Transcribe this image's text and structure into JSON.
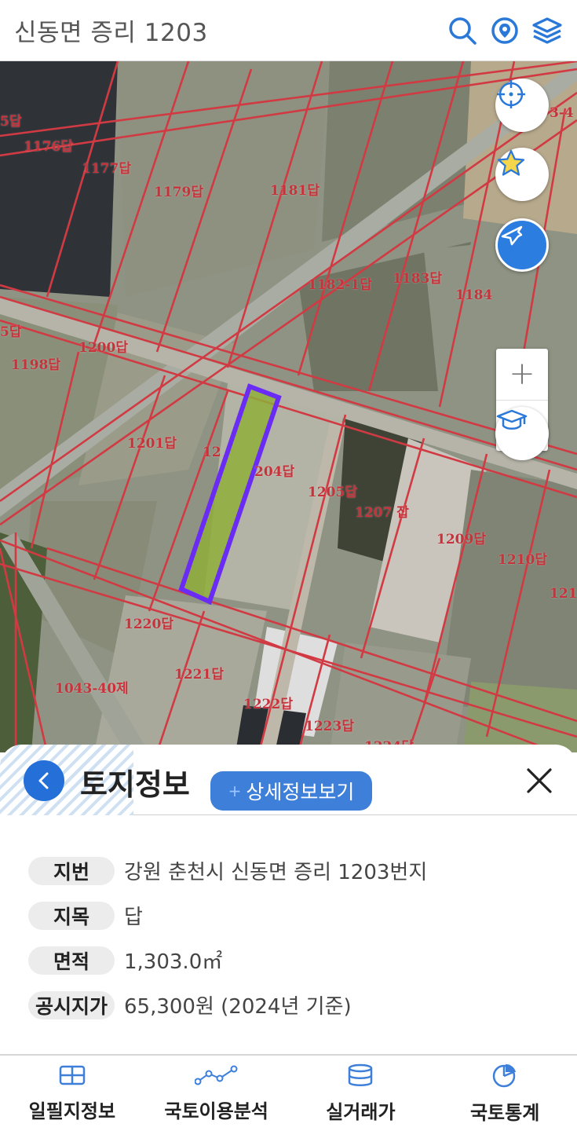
{
  "header": {
    "title": "신동면 증리 1203",
    "icons": [
      "search-icon",
      "location-pin-icon",
      "layers-icon"
    ]
  },
  "map": {
    "parcel_labels": [
      {
        "text": "5답"
      },
      {
        "text": "1176답"
      },
      {
        "text": "1177답"
      },
      {
        "text": "1179답"
      },
      {
        "text": "1181답"
      },
      {
        "text": "1182-1답"
      },
      {
        "text": "1183답"
      },
      {
        "text": "1184"
      },
      {
        "text": "5답"
      },
      {
        "text": "1200답"
      },
      {
        "text": "1198답"
      },
      {
        "text": "1201답"
      },
      {
        "text": "12"
      },
      {
        "text": "204답"
      },
      {
        "text": "1205답"
      },
      {
        "text": "1207 잡"
      },
      {
        "text": "1209답"
      },
      {
        "text": "1210답"
      },
      {
        "text": "121"
      },
      {
        "text": "1220답"
      },
      {
        "text": "1221답"
      },
      {
        "text": "1043-40제"
      },
      {
        "text": "1222답"
      },
      {
        "text": "1223답"
      },
      {
        "text": "1224답"
      },
      {
        "text": "3-4"
      }
    ],
    "controls": {
      "gps": "crosshair-icon",
      "favorite": "star-icon",
      "drone": "airplane-icon",
      "zoom_in": "+",
      "zoom_out": "—",
      "education": "graduation-cap-icon"
    },
    "colors": {
      "parcel_line": "#d23a43",
      "selected_outline": "#6a2cf5",
      "selected_fill": "#8fae3a"
    }
  },
  "panel": {
    "title": "토지정보",
    "detail_button": "상세정보보기",
    "detail_plus": "+",
    "rows": [
      {
        "label": "지번",
        "value": "강원 춘천시 신동면 증리 1203번지"
      },
      {
        "label": "지목",
        "value": "답"
      },
      {
        "label": "면적",
        "value": "1,303.0㎡"
      },
      {
        "label": "공시지가",
        "value": "65,300원 (2024년 기준)"
      }
    ]
  },
  "bottom_nav": [
    {
      "label": "일필지정보",
      "icon": "grid-icon"
    },
    {
      "label": "국토이용분석",
      "icon": "analysis-line-icon"
    },
    {
      "label": "실거래가",
      "icon": "database-icon"
    },
    {
      "label": "국토통계",
      "icon": "pie-chart-icon"
    }
  ],
  "colors": {
    "accent": "#2470d8",
    "button": "#3d7fd9"
  }
}
